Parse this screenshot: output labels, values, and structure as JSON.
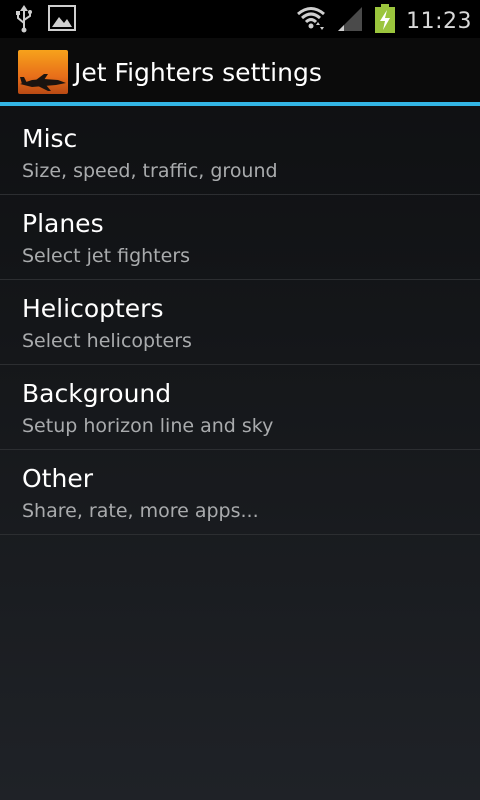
{
  "status_bar": {
    "time": "11:23",
    "left_icons": [
      "usb-icon",
      "image-icon"
    ],
    "right_icons": [
      "wifi-icon",
      "signal-icon",
      "battery-charging-icon"
    ],
    "battery_color": "#9bc53d"
  },
  "action_bar": {
    "title": "Jet Fighters settings",
    "accent_color": "#33b5e5"
  },
  "settings": {
    "items": [
      {
        "title": "Misc",
        "summary": "Size, speed, traffic, ground"
      },
      {
        "title": "Planes",
        "summary": "Select jet fighters"
      },
      {
        "title": "Helicopters",
        "summary": "Select helicopters"
      },
      {
        "title": "Background",
        "summary": "Setup horizon line and sky"
      },
      {
        "title": "Other",
        "summary": "Share, rate, more apps..."
      }
    ]
  }
}
